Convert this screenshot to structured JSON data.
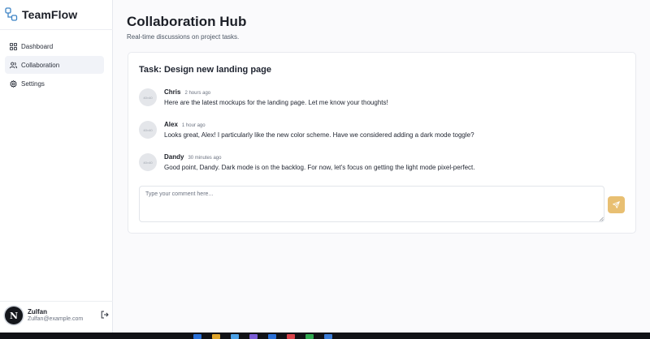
{
  "app": {
    "brand": "TeamFlow"
  },
  "sidebar": {
    "items": [
      {
        "label": "Dashboard",
        "icon": "dashboard-grid-icon",
        "active": false
      },
      {
        "label": "Collaboration",
        "icon": "users-icon",
        "active": true
      },
      {
        "label": "Settings",
        "icon": "gear-icon",
        "active": false
      }
    ]
  },
  "user": {
    "initial": "N",
    "name": "Zulfan",
    "email": "Zulfan@example.com",
    "logout_icon": "logout-icon"
  },
  "page": {
    "title": "Collaboration Hub",
    "subtitle": "Real-time discussions on project tasks."
  },
  "task": {
    "title": "Task: Design new landing page",
    "comments": [
      {
        "author": "Chris",
        "time": "2 hours ago",
        "avatar_alt": "40×40",
        "text": "Here are the latest mockups for the landing page. Let me know your thoughts!"
      },
      {
        "author": "Alex",
        "time": "1 hour ago",
        "avatar_alt": "40×40",
        "text": "Looks great, Alex! I particularly like the new color scheme. Have we considered adding a dark mode toggle?"
      },
      {
        "author": "Dandy",
        "time": "30 minutes ago",
        "avatar_alt": "40×40",
        "text": "Good point, Dandy. Dark mode is on the backlog. For now, let's focus on getting the light mode pixel-perfect."
      }
    ],
    "composer": {
      "placeholder": "Type your comment here...",
      "value": "",
      "send_icon": "send-icon"
    }
  },
  "colors": {
    "accent": "#e8bf72",
    "active_nav": "#f1f3f8",
    "border": "#e8eaef"
  }
}
